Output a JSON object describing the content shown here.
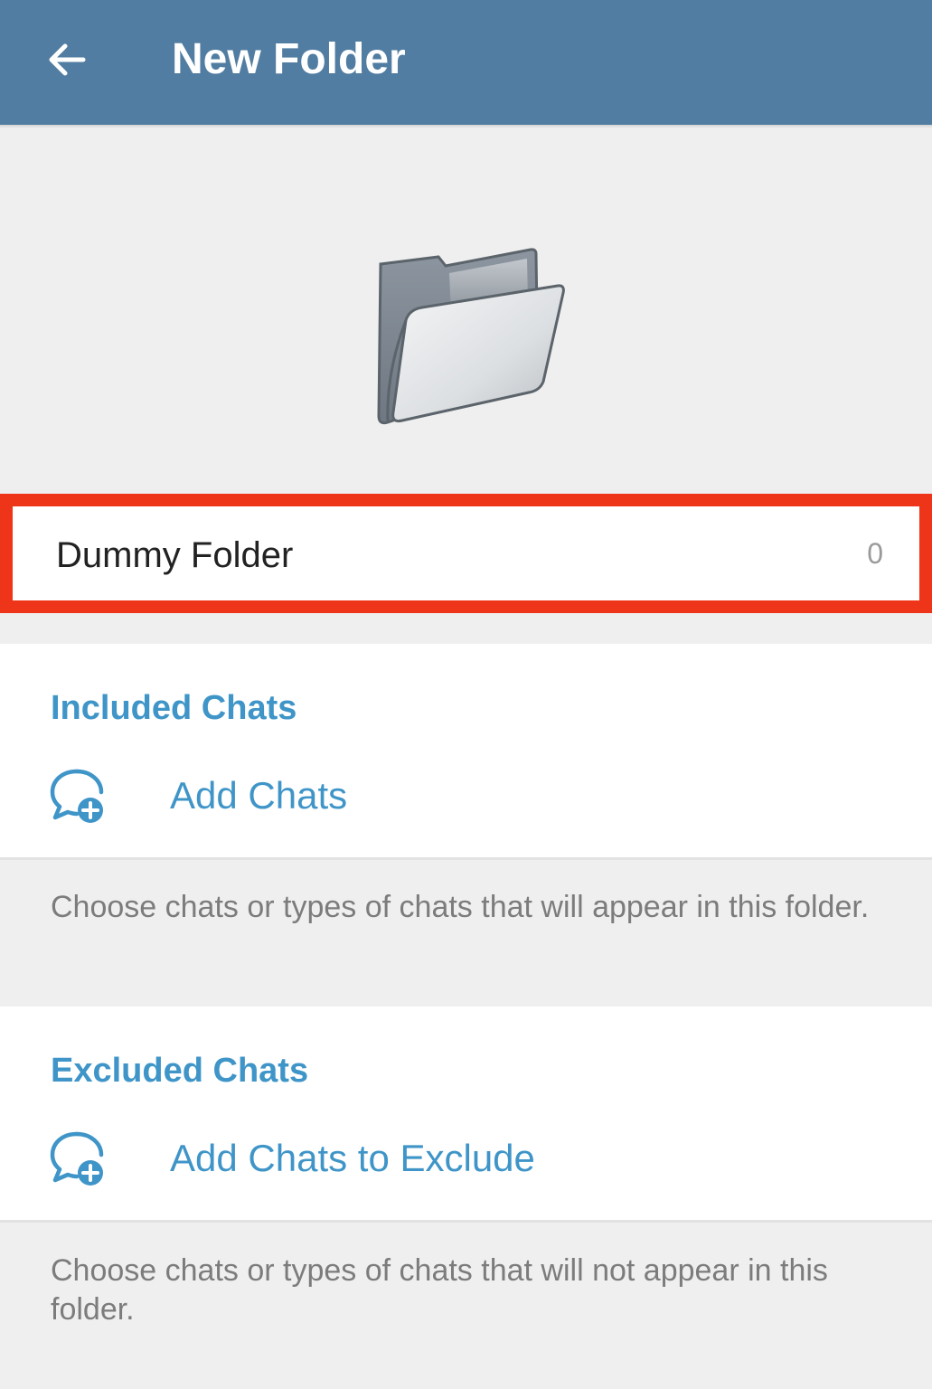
{
  "header": {
    "title": "New Folder",
    "back_icon": "arrow-left-icon",
    "background_color": "#517da2"
  },
  "illustration": {
    "icon": "folder-icon"
  },
  "name_field": {
    "value": "Dummy Folder",
    "counter": "0",
    "highlight_color": "#ee3419"
  },
  "included": {
    "header": "Included Chats",
    "action_label": "Add Chats",
    "action_icon": "chat-add-icon",
    "hint": "Choose chats or types of chats that will appear in this folder."
  },
  "excluded": {
    "header": "Excluded Chats",
    "action_label": "Add Chats to Exclude",
    "action_icon": "chat-add-icon",
    "hint": "Choose chats or types of chats that will not appear in this folder."
  },
  "colors": {
    "accent": "#3f95c8",
    "page_background": "#efefef"
  }
}
